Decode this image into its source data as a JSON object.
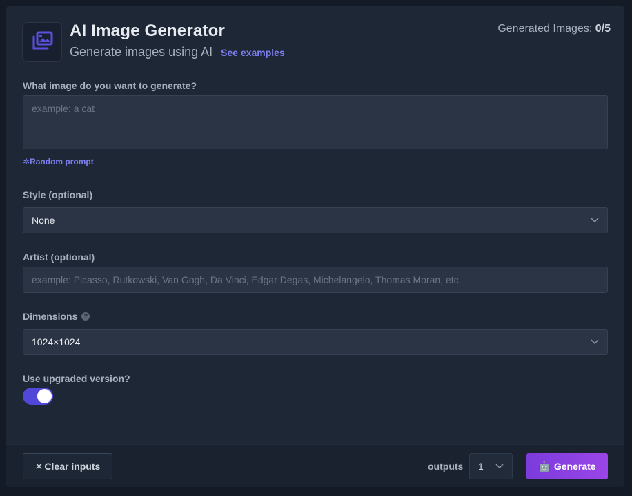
{
  "header": {
    "title": "AI Image Generator",
    "subtitle": "Generate images using AI",
    "see_examples": "See examples",
    "counter_label": "Generated Images:",
    "counter_value": "0/5",
    "logo_icon": "images-icon"
  },
  "prompt": {
    "label": "What image do you want to generate?",
    "value": "",
    "placeholder": "example: a cat",
    "random_label": "Random prompt",
    "random_icon": "sparkle-icon"
  },
  "style": {
    "label": "Style (optional)",
    "selected": "None"
  },
  "artist": {
    "label": "Artist (optional)",
    "value": "",
    "placeholder": "example: Picasso, Rutkowski, Van Gogh, Da Vinci, Edgar Degas, Michelangelo, Thomas Moran, etc."
  },
  "dimensions": {
    "label": "Dimensions",
    "help_glyph": "?",
    "selected": "1024×1024"
  },
  "upgraded": {
    "label": "Use upgraded version?",
    "enabled": true
  },
  "footer": {
    "clear_glyph": "✕",
    "clear_label": "Clear inputs",
    "outputs_label": "outputs",
    "outputs_selected": "1",
    "generate_emoji": "🤖",
    "generate_label": "Generate"
  },
  "colors": {
    "accent": "#7d7ff0",
    "toggle_on": "#5148d8",
    "generate_start": "#7c3bdc",
    "generate_end": "#9a45e8"
  }
}
